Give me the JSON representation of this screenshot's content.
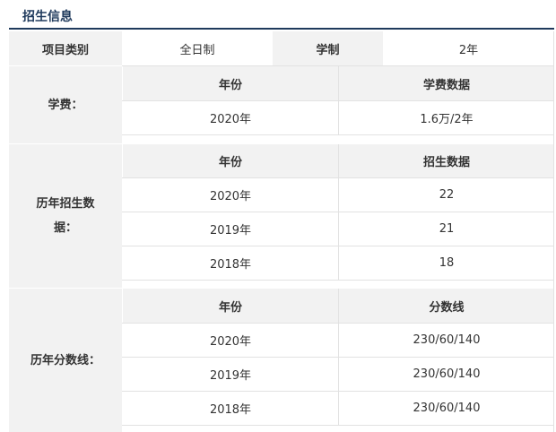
{
  "header": {
    "title": "招生信息"
  },
  "info_row": {
    "label_type": "项目类别",
    "value_type": "全日制",
    "label_duration": "学制",
    "value_duration": "2年"
  },
  "tuition": {
    "label": "学费：",
    "col_year": "年份",
    "col_value": "学费数据",
    "rows": [
      {
        "year": "2020年",
        "value": "1.6万/2年"
      }
    ]
  },
  "enrollment": {
    "label": "历年招生数据：",
    "col_year": "年份",
    "col_value": "招生数据",
    "rows": [
      {
        "year": "2020年",
        "value": "22"
      },
      {
        "year": "2019年",
        "value": "21"
      },
      {
        "year": "2018年",
        "value": "18"
      }
    ]
  },
  "score_line": {
    "label": "历年分数线：",
    "col_year": "年份",
    "col_value": "分数线",
    "rows": [
      {
        "year": "2020年",
        "value": "230/60/140"
      },
      {
        "year": "2019年",
        "value": "230/60/140"
      },
      {
        "year": "2018年",
        "value": "230/60/140"
      }
    ]
  }
}
